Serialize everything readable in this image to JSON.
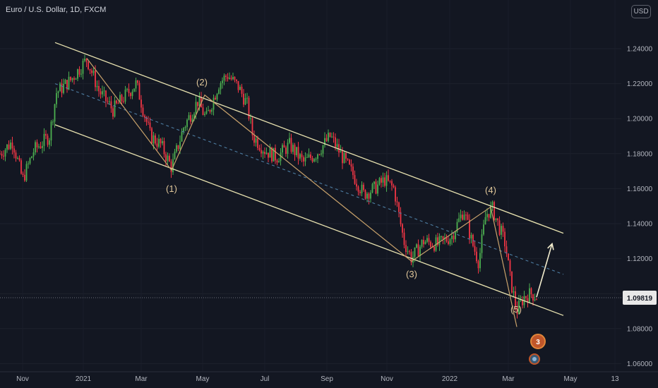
{
  "header": {
    "symbol_title": "Euro / U.S. Dollar, 1D, FXCM",
    "currency": "USD"
  },
  "chart_data": {
    "type": "candlestick",
    "x_ticks": [
      "Nov",
      "2021",
      "Mar",
      "May",
      "Jul",
      "Sep",
      "Nov",
      "2022",
      "Mar",
      "May",
      "13"
    ],
    "y_ticks": [
      "1.24000",
      "1.22000",
      "1.20000",
      "1.18000",
      "1.16000",
      "1.14000",
      "1.12000",
      "1.10000",
      "1.08000",
      "1.06000"
    ],
    "ylim": [
      1.0585,
      1.2525
    ],
    "last_price": "1.09819",
    "colors": {
      "up": "#4caf50",
      "down": "#f23645",
      "channel": "#e9e3b0",
      "wave": "#c9a26b",
      "midline": "#4e7ea3",
      "label": "#e0c79a",
      "arrow": "#f2eccd"
    },
    "wave_labels": [
      "(1)",
      "(2)",
      "(3)",
      "(4)",
      "(5)"
    ],
    "wave_path": [
      {
        "t": 123,
        "p": 1.2345
      },
      {
        "t": 243,
        "p": 1.1705
      },
      {
        "t": 290,
        "p": 1.2135
      },
      {
        "t": 583,
        "p": 1.1185
      },
      {
        "t": 695,
        "p": 1.1495
      },
      {
        "t": 732,
        "p": 1.081
      }
    ],
    "channel_upper": [
      {
        "t": 78,
        "p": 1.2435
      },
      {
        "t": 798,
        "p": 1.1345
      }
    ],
    "channel_lower": [
      {
        "t": 78,
        "p": 1.1965
      },
      {
        "t": 798,
        "p": 1.0875
      }
    ],
    "channel_midline": [
      {
        "t": 78,
        "p": 1.22
      },
      {
        "t": 798,
        "p": 1.111
      }
    ],
    "projection_arrow": [
      {
        "t": 760,
        "p": 1.098
      },
      {
        "t": 782,
        "p": 1.1285
      }
    ],
    "price_path": [
      [
        0,
        1.18
      ],
      [
        18,
        1.187
      ],
      [
        32,
        1.165
      ],
      [
        48,
        1.182
      ],
      [
        70,
        1.19
      ],
      [
        80,
        1.215
      ],
      [
        100,
        1.222
      ],
      [
        123,
        1.234
      ],
      [
        140,
        1.216
      ],
      [
        160,
        1.205
      ],
      [
        175,
        1.212
      ],
      [
        193,
        1.22
      ],
      [
        213,
        1.19
      ],
      [
        228,
        1.185
      ],
      [
        243,
        1.172
      ],
      [
        260,
        1.195
      ],
      [
        280,
        1.21
      ],
      [
        292,
        1.2
      ],
      [
        310,
        1.22
      ],
      [
        322,
        1.225
      ],
      [
        338,
        1.218
      ],
      [
        350,
        1.208
      ],
      [
        358,
        1.19
      ],
      [
        375,
        1.182
      ],
      [
        392,
        1.178
      ],
      [
        410,
        1.185
      ],
      [
        430,
        1.175
      ],
      [
        448,
        1.18
      ],
      [
        468,
        1.19
      ],
      [
        485,
        1.178
      ],
      [
        500,
        1.168
      ],
      [
        515,
        1.157
      ],
      [
        530,
        1.16
      ],
      [
        545,
        1.165
      ],
      [
        558,
        1.16
      ],
      [
        572,
        1.13
      ],
      [
        583,
        1.12
      ],
      [
        600,
        1.13
      ],
      [
        620,
        1.128
      ],
      [
        640,
        1.133
      ],
      [
        657,
        1.148
      ],
      [
        668,
        1.13
      ],
      [
        678,
        1.118
      ],
      [
        688,
        1.145
      ],
      [
        697,
        1.149
      ],
      [
        707,
        1.138
      ],
      [
        716,
        1.128
      ],
      [
        722,
        1.11
      ],
      [
        732,
        1.09
      ],
      [
        742,
        1.098
      ],
      [
        752,
        1.1
      ],
      [
        762,
        1.098
      ]
    ]
  }
}
